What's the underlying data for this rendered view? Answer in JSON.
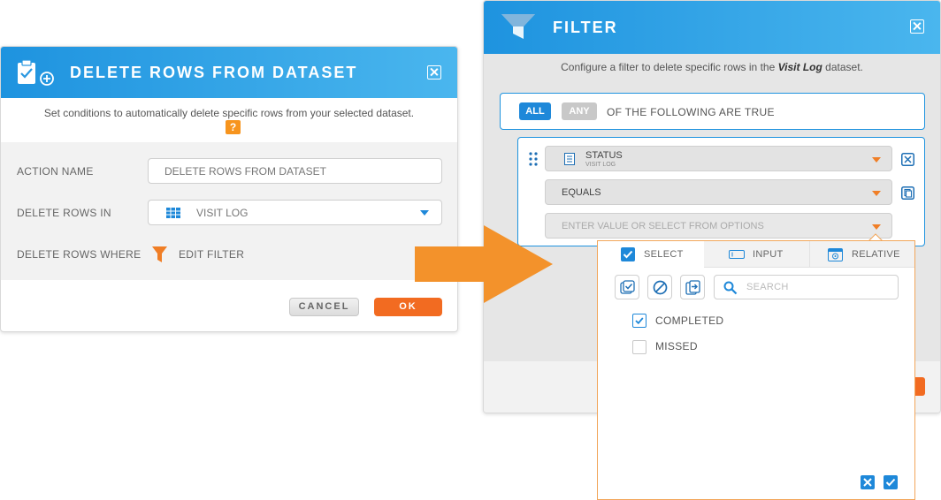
{
  "delete_dialog": {
    "title": "DELETE ROWS FROM DATASET",
    "subtitle": "Set conditions to automatically delete specific rows from your selected dataset.",
    "help": "?",
    "action_name_label": "ACTION NAME",
    "action_name_value": "DELETE ROWS FROM DATASET",
    "delete_rows_in_label": "DELETE ROWS IN",
    "delete_rows_in_value": "VISIT LOG",
    "delete_rows_where_label": "DELETE ROWS WHERE",
    "edit_filter_label": "EDIT FILTER",
    "cancel_label": "CANCEL",
    "ok_label": "OK"
  },
  "filter_dialog": {
    "title": "FILTER",
    "subtitle_prefix": "Configure a filter to delete specific rows in the ",
    "subtitle_dataset": "Visit Log",
    "subtitle_suffix": " dataset.",
    "all_label": "ALL",
    "any_label": "ANY",
    "of_following": "OF THE FOLLOWING ARE TRUE",
    "field_name": "STATUS",
    "field_source": "VISIT LOG",
    "operator": "EQUALS",
    "value_placeholder": "ENTER VALUE OR SELECT FROM OPTIONS"
  },
  "options_panel": {
    "tabs": [
      "SELECT",
      "INPUT",
      "RELATIVE"
    ],
    "search_placeholder": "SEARCH",
    "options": [
      {
        "label": "COMPLETED",
        "checked": true
      },
      {
        "label": "MISSED",
        "checked": false
      }
    ]
  },
  "colors": {
    "accent": "#1e93df",
    "orange": "#f26b21"
  }
}
